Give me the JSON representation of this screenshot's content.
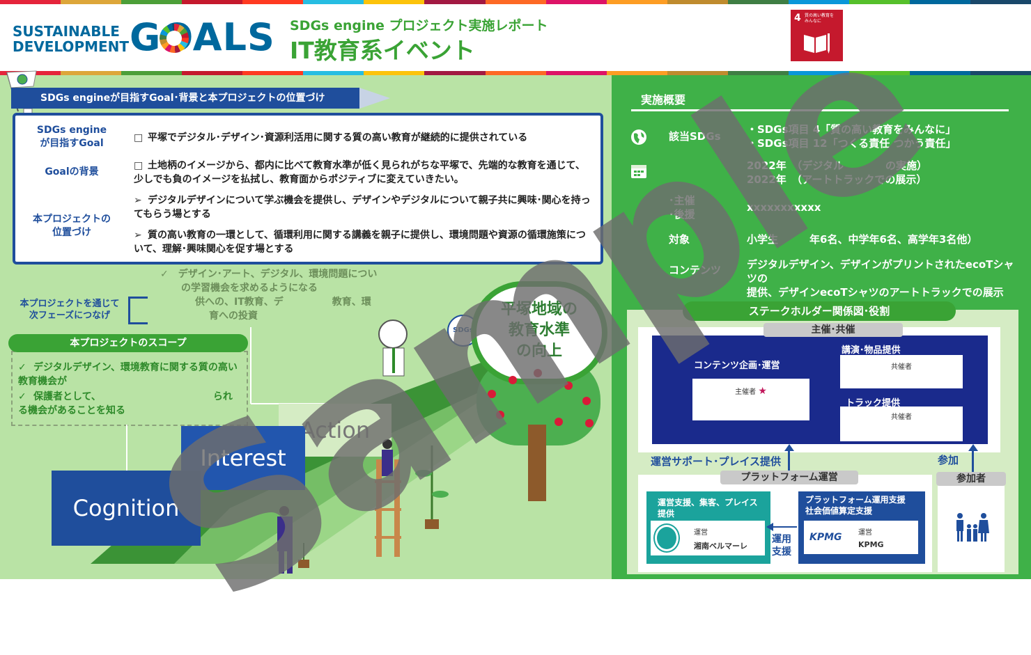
{
  "header": {
    "logo_line1": "SUSTAINABLE",
    "logo_line2": "DEVELOPMENT",
    "logo_goals": "GOALS",
    "subtitle": "SDGs engine プロジェクト実施レポート",
    "title": "IT教育系イベント",
    "goal_badge": {
      "number": "4",
      "label_line1": "質の高い教育を",
      "label_line2": "みんなに",
      "color": "#c5192d"
    },
    "bar_colors": [
      "#e5243b",
      "#dda63a",
      "#4c9f38",
      "#c5192d",
      "#ff3a21",
      "#26bde2",
      "#fcc30b",
      "#a21942",
      "#fd6925",
      "#dd1367",
      "#fd9d24",
      "#bf8b2e",
      "#3f7e44",
      "#0a97d9",
      "#56c02b",
      "#00689d",
      "#19486a"
    ]
  },
  "left": {
    "section_title": "SDGs engineが目指すGoal･背景と本プロジェクトの位置づけ",
    "rows": [
      {
        "label": "SDGs engine\nが目指すGoal",
        "items": [
          {
            "marker": "□",
            "text": "平塚でデジタル･デザイン･資源利活用に関する質の高い教育が継続的に提供されている"
          }
        ]
      },
      {
        "label": "Goalの背景",
        "items": [
          {
            "marker": "□",
            "text": "土地柄のイメージから、都内に比べて教育水準が低く見られがちな平塚で、先端的な教育を通じて、少しでも負のイメージを払拭し、教育面からポジティブに変えていきたい。"
          }
        ]
      },
      {
        "label": "本プロジェクトの\n位置づけ",
        "items": [
          {
            "marker": "➢",
            "text": "デジタルデザインについて学ぶ機会を提供し、デザインやデジタルについて親子共に興味･関心を持ってもらう場とする"
          },
          {
            "marker": "➢",
            "text": "質の高い教育の一環として、循環利用に関する講義を親子に提供し、環境問題や資源の循環施策について、理解･興味関心を促す場とする"
          }
        ]
      }
    ],
    "note_lines": [
      "✓　デザイン･アート、デジタル、環境問題につい",
      "の学習機会を求めるようになる",
      "供への、IT教育、デ　　　　　教育、環",
      "育への投資"
    ],
    "next_phase": "本プロジェクトを通じて\n次フェーズにつなげ",
    "scope_title": "本プロジェクトのスコープ",
    "scope_items": [
      {
        "check": "✓",
        "text": "デジタルデザイン、環境教育に関する質の高い教育機会が"
      },
      {
        "check": "✓",
        "text": "保護者として、　　　　　　　　　　　　られる機会があることを知る"
      }
    ],
    "stairs": [
      "Cognition",
      "Interest",
      "Action"
    ],
    "goal_circle": "平塚地域の\n教育水準\nの向上",
    "sdgs_bubble": "SDGs"
  },
  "right": {
    "heading": "実施概要",
    "rows": [
      {
        "icon": "globe-icon",
        "key": "該当SDGs",
        "value": "・SDGs項目 4「質の高い教育をみんなに」\n・SDGs項目 12「つくる責任 つかう責任」"
      },
      {
        "icon": "calendar-icon",
        "key": "",
        "value": "2022年　（デジタル　　　　の実施）\n2022年　（アートトラックでの展示）"
      },
      {
        "icon": "",
        "key": "･主催\n･後援",
        "value": "xxxxxxxxxxx"
      },
      {
        "icon": "",
        "key": "対象",
        "value": "小学生　　　年6名、中学年6名、高学年3名他）"
      },
      {
        "icon": "",
        "key": "コンテンツ",
        "value": "デジタルデザイン、デザインがプリントされたecoTシャツの\n提供、デザインecoTシャツのアートトラックでの展示"
      }
    ],
    "stakeholder_title": "ステークホルダー関係図･役割",
    "host_tag": "主催･共催",
    "content_label": "コンテンツ企画･運営",
    "organizer_label": "主催者",
    "star": "★",
    "lecture_label": "講演･物品提供",
    "co_host_1": "共催者",
    "truck_label": "トラック提供",
    "co_host_2": "共催者",
    "support_label": "運営サポート･プレイス提供",
    "join_label": "参加",
    "platform_tag": "プラットフォーム運営",
    "participant_tag": "参加者",
    "teal_title": "運営支援、集客、プレイス提供",
    "teal_role": "運営",
    "teal_name": "湘南ベルマーレ",
    "ops_support": "運用\n支援",
    "blue_title": "プラットフォーム運用支援\n社会価値算定支援",
    "blue_role": "運営",
    "blue_logo": "KPMG",
    "blue_name": "KPMG"
  },
  "watermark": "Sample"
}
